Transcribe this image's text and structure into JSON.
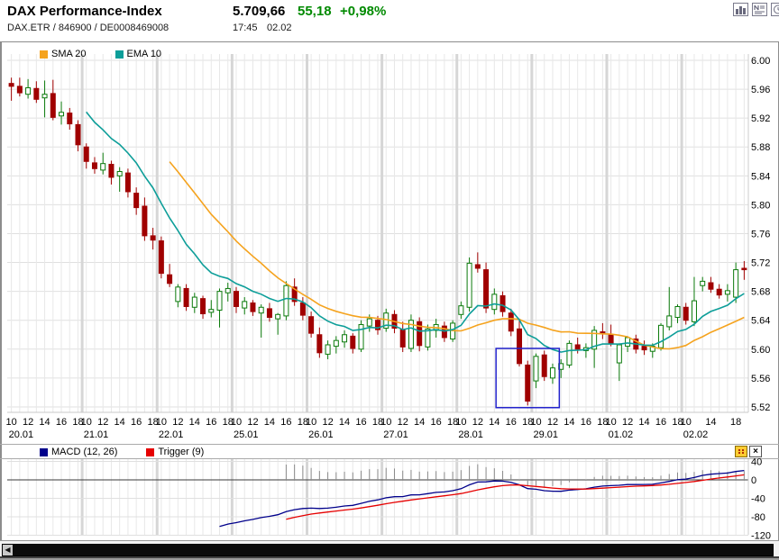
{
  "header": {
    "title": "DAX Performance-Index",
    "price": "5.709,66",
    "change": "55,18",
    "change_pct": "+0,98%",
    "instrument": "DAX.ETR / 846900 / DE0008469008",
    "time": "17:45",
    "date": "02.02"
  },
  "colors": {
    "up": "#0b7a0b",
    "down": "#a00000",
    "sma": "#f5a31e",
    "ema": "#0d9e99",
    "macd": "#00008b",
    "trigger": "#e60000",
    "histogram": "#8a8a8a",
    "annotation_box": "#2222cc",
    "positive_text": "#008a00",
    "grid_thin": "#e8e8e8",
    "grid_thick": "#d6d6d6",
    "grid_h": "#e0e0e0",
    "zero_line": "#3a3a3a"
  },
  "main_chart": {
    "legend": [
      {
        "label": "SMA 20",
        "color": "#f5a31e"
      },
      {
        "label": "EMA 10",
        "color": "#0d9e99"
      }
    ],
    "y_axis": {
      "ticks": [
        {
          "v": 6000,
          "t": "6.00"
        },
        {
          "v": 5960,
          "t": "5.96"
        },
        {
          "v": 5920,
          "t": "5.92"
        },
        {
          "v": 5880,
          "t": "5.88"
        },
        {
          "v": 5840,
          "t": "5.84"
        },
        {
          "v": 5800,
          "t": "5.80"
        },
        {
          "v": 5760,
          "t": "5.76"
        },
        {
          "v": 5720,
          "t": "5.72"
        },
        {
          "v": 5680,
          "t": "5.68"
        },
        {
          "v": 5640,
          "t": "5.64"
        },
        {
          "v": 5600,
          "t": "5.60"
        },
        {
          "v": 5560,
          "t": "5.56"
        },
        {
          "v": 5520,
          "t": "5.52"
        }
      ]
    },
    "annotation_box": {
      "from_candle": 58.2,
      "to_candle": 65.8,
      "price_top": 5601,
      "price_bottom": 5519
    }
  },
  "macd_panel": {
    "legend": [
      {
        "label": "MACD (12, 26)",
        "color": "#00008b"
      },
      {
        "label": "Trigger (9)",
        "color": "#e60000"
      }
    ],
    "y_axis": {
      "ticks": [
        {
          "v": 40,
          "t": "40"
        },
        {
          "v": 0,
          "t": "0"
        },
        {
          "v": -40,
          "t": "-40"
        },
        {
          "v": -80,
          "t": "-80"
        },
        {
          "v": -120,
          "t": "-120"
        }
      ]
    },
    "close_glyph": "×"
  },
  "scrollbar": {
    "left_arrow_glyph": "◀"
  },
  "chart_data": [
    {
      "type": "candlestick",
      "title": "DAX Performance-Index intraday (hourly candles)",
      "ylim": [
        5520,
        6000
      ],
      "indicators": [
        {
          "name": "SMA",
          "period": 20
        },
        {
          "name": "EMA",
          "period": 10
        }
      ],
      "days": [
        {
          "date": "20.01",
          "hour_ticks": [
            [
              0,
              "10"
            ],
            [
              2,
              "12"
            ],
            [
              4,
              "14"
            ],
            [
              6,
              "16"
            ],
            [
              8,
              "18"
            ]
          ],
          "candles": [
            [
              5968,
              5976,
              5944,
              5964
            ],
            [
              5964,
              5976,
              5950,
              5955
            ],
            [
              5953,
              5974,
              5947,
              5962
            ],
            [
              5961,
              5971,
              5941,
              5946
            ],
            [
              5948,
              5972,
              5921,
              5953
            ],
            [
              5954,
              5973,
              5917,
              5921
            ],
            [
              5923,
              5943,
              5911,
              5928
            ],
            [
              5927,
              5934,
              5904,
              5912
            ],
            [
              5911,
              5917,
              5874,
              5883
            ]
          ]
        },
        {
          "date": "21.01",
          "hour_ticks": [
            [
              0,
              "10"
            ],
            [
              2,
              "12"
            ],
            [
              4,
              "14"
            ],
            [
              6,
              "16"
            ],
            [
              8,
              "18"
            ]
          ],
          "candles": [
            [
              5880,
              5885,
              5850,
              5860
            ],
            [
              5858,
              5866,
              5843,
              5850
            ],
            [
              5848,
              5872,
              5842,
              5857
            ],
            [
              5856,
              5861,
              5828,
              5838
            ],
            [
              5840,
              5852,
              5818,
              5846
            ],
            [
              5844,
              5850,
              5810,
              5818
            ],
            [
              5816,
              5824,
              5786,
              5796
            ],
            [
              5798,
              5810,
              5750,
              5757
            ],
            [
              5757,
              5768,
              5738,
              5751
            ]
          ]
        },
        {
          "date": "22.01",
          "hour_ticks": [
            [
              0,
              "10"
            ],
            [
              2,
              "12"
            ],
            [
              4,
              "14"
            ],
            [
              6,
              "16"
            ],
            [
              8,
              "18"
            ]
          ],
          "candles": [
            [
              5750,
              5756,
              5698,
              5705
            ],
            [
              5703,
              5718,
              5686,
              5691
            ],
            [
              5666,
              5690,
              5658,
              5686
            ],
            [
              5684,
              5690,
              5653,
              5659
            ],
            [
              5658,
              5678,
              5650,
              5672
            ],
            [
              5670,
              5674,
              5642,
              5649
            ],
            [
              5651,
              5668,
              5644,
              5655
            ],
            [
              5654,
              5684,
              5630,
              5680
            ],
            [
              5678,
              5692,
              5666,
              5684
            ]
          ]
        },
        {
          "date": "25.01",
          "hour_ticks": [
            [
              0,
              "10"
            ],
            [
              2,
              "12"
            ],
            [
              4,
              "14"
            ],
            [
              6,
              "16"
            ],
            [
              8,
              "18"
            ]
          ],
          "candles": [
            [
              5680,
              5686,
              5650,
              5659
            ],
            [
              5657,
              5672,
              5648,
              5666
            ],
            [
              5664,
              5668,
              5646,
              5652
            ],
            [
              5650,
              5662,
              5616,
              5658
            ],
            [
              5656,
              5664,
              5638,
              5644
            ],
            [
              5642,
              5650,
              5620,
              5648
            ],
            [
              5646,
              5694,
              5640,
              5688
            ],
            [
              5686,
              5698,
              5660,
              5666
            ],
            [
              5664,
              5672,
              5640,
              5647
            ]
          ]
        },
        {
          "date": "26.01",
          "hour_ticks": [
            [
              0,
              "10"
            ],
            [
              2,
              "12"
            ],
            [
              4,
              "14"
            ],
            [
              6,
              "16"
            ],
            [
              8,
              "18"
            ]
          ],
          "candles": [
            [
              5645,
              5652,
              5616,
              5622
            ],
            [
              5620,
              5630,
              5588,
              5595
            ],
            [
              5593,
              5612,
              5586,
              5606
            ],
            [
              5604,
              5618,
              5594,
              5612
            ],
            [
              5610,
              5626,
              5602,
              5620
            ],
            [
              5618,
              5622,
              5594,
              5601
            ],
            [
              5600,
              5640,
              5596,
              5634
            ],
            [
              5632,
              5648,
              5624,
              5642
            ],
            [
              5640,
              5646,
              5620,
              5627
            ]
          ]
        },
        {
          "date": "27.01",
          "hour_ticks": [
            [
              0,
              "10"
            ],
            [
              2,
              "12"
            ],
            [
              4,
              "14"
            ],
            [
              6,
              "16"
            ],
            [
              8,
              "18"
            ]
          ],
          "candles": [
            [
              5629,
              5656,
              5624,
              5650
            ],
            [
              5648,
              5654,
              5622,
              5629
            ],
            [
              5627,
              5638,
              5596,
              5603
            ],
            [
              5601,
              5648,
              5596,
              5640
            ],
            [
              5638,
              5644,
              5597,
              5605
            ],
            [
              5603,
              5634,
              5598,
              5628
            ],
            [
              5626,
              5642,
              5616,
              5634
            ],
            [
              5632,
              5638,
              5610,
              5616
            ],
            [
              5614,
              5640,
              5610,
              5636
            ]
          ]
        },
        {
          "date": "28.01",
          "hour_ticks": [
            [
              0,
              "10"
            ],
            [
              2,
              "12"
            ],
            [
              4,
              "14"
            ],
            [
              6,
              "16"
            ],
            [
              8,
              "18"
            ]
          ],
          "candles": [
            [
              5648,
              5666,
              5642,
              5660
            ],
            [
              5658,
              5727,
              5652,
              5719
            ],
            [
              5717,
              5734,
              5706,
              5712
            ],
            [
              5710,
              5720,
              5650,
              5657
            ],
            [
              5655,
              5684,
              5648,
              5676
            ],
            [
              5674,
              5680,
              5645,
              5652
            ],
            [
              5650,
              5656,
              5618,
              5625
            ],
            [
              5628,
              5640,
              5576,
              5580
            ],
            [
              5578,
              5584,
              5522,
              5528
            ]
          ]
        },
        {
          "date": "29.01",
          "hour_ticks": [
            [
              0,
              "10"
            ],
            [
              2,
              "12"
            ],
            [
              4,
              "14"
            ],
            [
              6,
              "16"
            ],
            [
              8,
              "18"
            ]
          ],
          "candles": [
            [
              5556,
              5594,
              5546,
              5590
            ],
            [
              5592,
              5598,
              5556,
              5562
            ],
            [
              5560,
              5580,
              5552,
              5574
            ],
            [
              5572,
              5586,
              5560,
              5580
            ],
            [
              5578,
              5612,
              5574,
              5608
            ],
            [
              5606,
              5616,
              5594,
              5600
            ],
            [
              5598,
              5608,
              5588,
              5602
            ],
            [
              5600,
              5632,
              5574,
              5626
            ],
            [
              5624,
              5636,
              5614,
              5621
            ]
          ]
        },
        {
          "date": "01.02",
          "hour_ticks": [
            [
              0,
              "10"
            ],
            [
              2,
              "12"
            ],
            [
              4,
              "14"
            ],
            [
              6,
              "16"
            ],
            [
              8,
              "18"
            ]
          ],
          "candles": [
            [
              5620,
              5634,
              5604,
              5608
            ],
            [
              5581,
              5608,
              5556,
              5606
            ],
            [
              5604,
              5618,
              5596,
              5616
            ],
            [
              5614,
              5620,
              5594,
              5600
            ],
            [
              5604,
              5612,
              5592,
              5599
            ],
            [
              5597,
              5608,
              5588,
              5604
            ],
            [
              5602,
              5636,
              5598,
              5633
            ],
            [
              5631,
              5686,
              5626,
              5646
            ],
            [
              5644,
              5662,
              5636,
              5659
            ]
          ]
        },
        {
          "date": "02.02",
          "hour_ticks": [
            [
              0,
              "10"
            ],
            [
              3,
              "14"
            ],
            [
              6,
              "18"
            ]
          ],
          "candles": [
            [
              5658,
              5664,
              5634,
              5640
            ],
            [
              5638,
              5700,
              5632,
              5667
            ],
            [
              5688,
              5700,
              5680,
              5694
            ],
            [
              5692,
              5700,
              5678,
              5683
            ],
            [
              5683,
              5690,
              5670,
              5675
            ],
            [
              5676,
              5690,
              5666,
              5681
            ],
            [
              5672,
              5720,
              5664,
              5710
            ],
            [
              5712,
              5722,
              5696,
              5710
            ]
          ]
        }
      ]
    },
    {
      "type": "line",
      "name": "MACD",
      "computed_from": "candles",
      "params": {
        "fast": 12,
        "slow": 26,
        "signal": 9
      },
      "ylim": [
        -120,
        40
      ]
    }
  ]
}
